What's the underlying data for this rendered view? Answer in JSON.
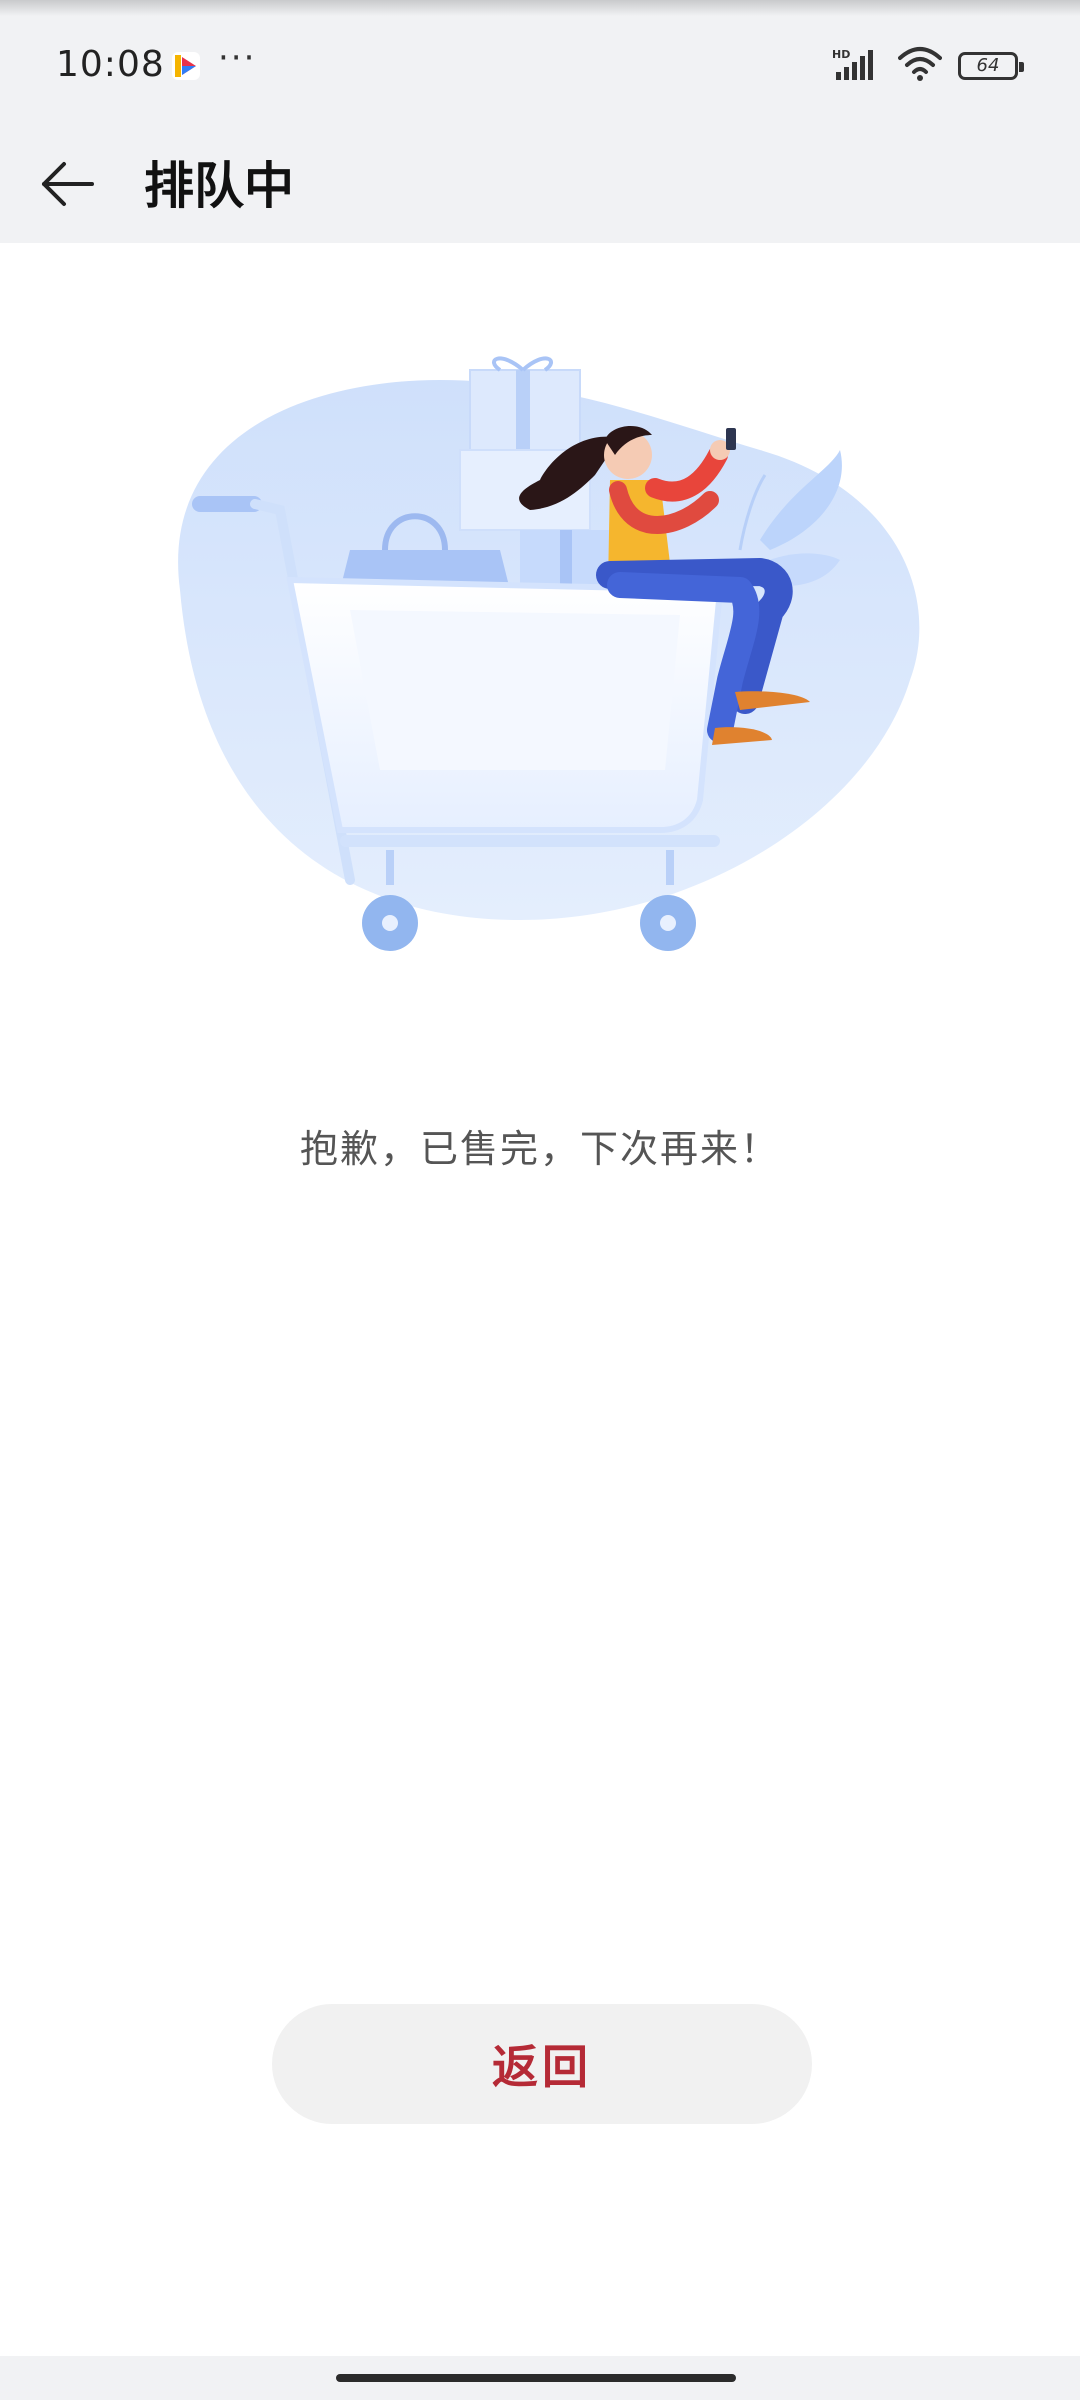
{
  "status_bar": {
    "time": "10:08",
    "overflow": "···",
    "battery_level": "64",
    "icons": [
      "app-icon",
      "hd-signal-icon",
      "wifi-icon",
      "battery-icon"
    ]
  },
  "nav": {
    "title": "排队中",
    "back_icon": "arrow-left-icon"
  },
  "illustration": {
    "description_icon": "shopping-cart-illustration"
  },
  "message": "抱歉，已售完，下次再来！",
  "return_button": {
    "label": "返回"
  },
  "colors": {
    "header_bg": "#f1f2f4",
    "accent": "#b52a36",
    "button_bg": "#f1f1f1",
    "text_secondary": "#555555"
  }
}
